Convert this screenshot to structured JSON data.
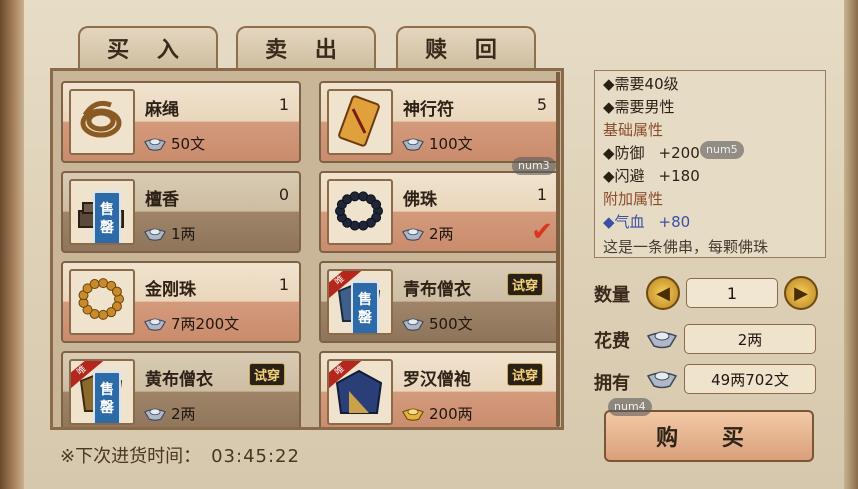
{
  "tabs": [
    {
      "label": "买 入",
      "active": true
    },
    {
      "label": "卖 出",
      "active": false
    },
    {
      "label": "赎 回",
      "active": false
    }
  ],
  "items": [
    {
      "name": "麻绳",
      "qty": "1",
      "price": "50文",
      "icon": "rope",
      "dark": false,
      "sold": false,
      "try": false,
      "currency": "silver"
    },
    {
      "name": "神行符",
      "qty": "5",
      "price": "100文",
      "icon": "talisman",
      "dark": false,
      "sold": false,
      "try": false,
      "currency": "silver"
    },
    {
      "name": "檀香",
      "qty": "0",
      "price": "1两",
      "icon": "incense",
      "dark": true,
      "sold": true,
      "try": false,
      "currency": "silver"
    },
    {
      "name": "佛珠",
      "qty": "1",
      "price": "2两",
      "icon": "beads-dark",
      "dark": false,
      "sold": false,
      "try": false,
      "currency": "silver",
      "checked": true
    },
    {
      "name": "金刚珠",
      "qty": "1",
      "price": "7两200文",
      "icon": "beads-gold",
      "dark": false,
      "sold": false,
      "try": false,
      "currency": "silver"
    },
    {
      "name": "青布僧衣",
      "qty": "",
      "price": "500文",
      "icon": "robe-blue",
      "dark": true,
      "sold": true,
      "try": true,
      "currency": "silver"
    },
    {
      "name": "黄布僧衣",
      "qty": "",
      "price": "2两",
      "icon": "robe-yellow",
      "dark": true,
      "sold": true,
      "try": true,
      "currency": "silver"
    },
    {
      "name": "罗汉僧袍",
      "qty": "",
      "price": "200两",
      "icon": "robe-arhat",
      "dark": false,
      "sold": false,
      "try": true,
      "currency": "gold"
    }
  ],
  "labels": {
    "sold": "售罄",
    "try": "试穿",
    "ribbon": "唯"
  },
  "restock": {
    "label": "※下次进货时间：",
    "time": "03:45:22"
  },
  "description": {
    "req_level": "◆需要40级",
    "req_gender": "◆需要男性",
    "base_title": "基础属性",
    "defense_label": "◆防御",
    "defense_value": "+200",
    "dodge_label": "◆闪避",
    "dodge_value": "+180",
    "extra_title": "附加属性",
    "hp_label": "◆气血",
    "hp_value": "+80",
    "flavor": "这是一条佛串，每颗佛珠"
  },
  "purchase": {
    "qty_label": "数量",
    "qty_value": "1",
    "cost_label": "花费",
    "cost_value": "2两",
    "own_label": "拥有",
    "own_value": "49两702文",
    "buy_label": "购 买"
  },
  "badges": {
    "num3": "num3",
    "num4": "num4",
    "num5": "num5"
  },
  "colors": {
    "accent_red": "#d9351f",
    "sold_blue": "#2d6aa8",
    "attr_blue": "#3b4fa4",
    "heading_brown": "#8b4c2c"
  }
}
